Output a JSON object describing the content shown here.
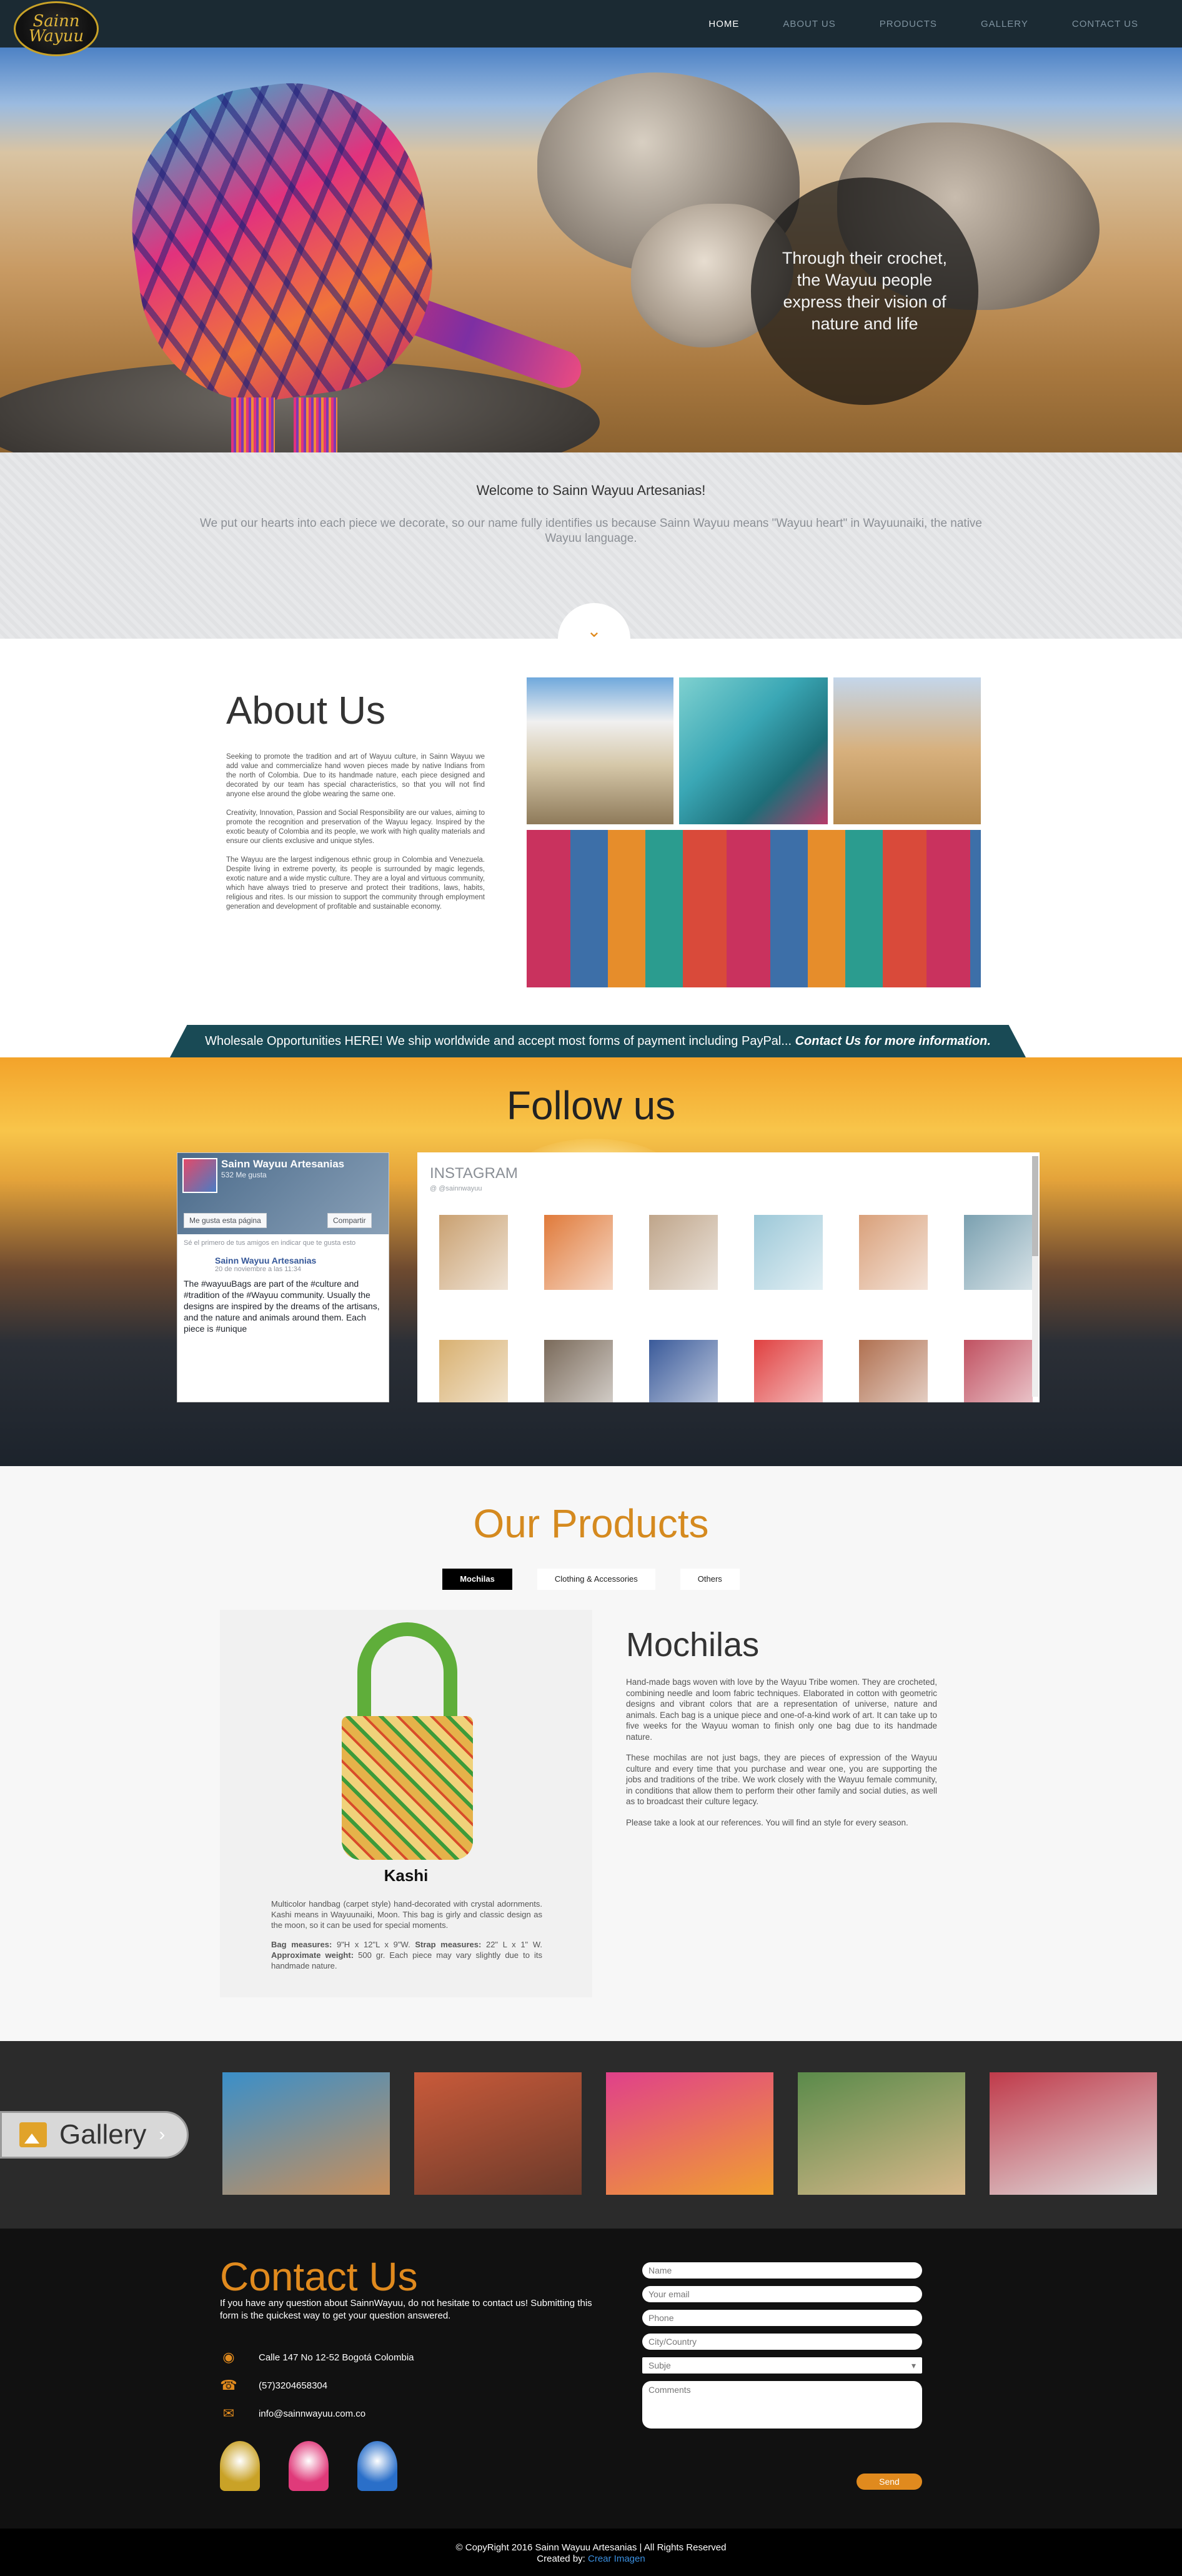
{
  "nav": {
    "logo_text": "Sainn Wayuu",
    "items": [
      {
        "label": "HOME",
        "active": true
      },
      {
        "label": "ABOUT US",
        "active": false
      },
      {
        "label": "PRODUCTS",
        "active": false
      },
      {
        "label": "GALLERY",
        "active": false
      },
      {
        "label": "CONTACT US",
        "active": false
      }
    ]
  },
  "hero": {
    "caption": "Through their crochet, the Wayuu people express their vision of nature and life"
  },
  "welcome": {
    "title": "Welcome to Sainn Wayuu Artesanias!",
    "text": "We put our hearts into each piece we decorate, so our name fully identifies us because Sainn Wayuu means \"Wayuu heart\" in Wayuunaiki, the native Wayuu language.",
    "scroll_icon": "chevron-down-icon"
  },
  "about": {
    "title": "About Us",
    "paragraphs": [
      "Seeking to promote the tradition and art of Wayuu culture, in Sainn Wayuu we add value and commercialize hand woven pieces made by native Indians from the north of Colombia. Due to its handmade nature, each piece designed and decorated by our team has special characteristics, so that you will not find anyone else around the globe wearing the same one.",
      "Creativity, Innovation, Passion and Social Responsibility are our values, aiming to promote the recognition and preservation of the Wayuu legacy. Inspired by the exotic beauty of Colombia and its people, we work with high quality materials and ensure our clients exclusive and unique styles.",
      "The Wayuu are the largest indigenous ethnic group in Colombia and Venezuela. Despite living in extreme poverty, its people is surrounded by magic legends, exotic nature and a wide mystic culture. They are a loyal and virtuous community, which have always tried to preserve and protect their traditions, laws, habits, religious and rites. Is our mission to support the community through employment generation and development of profitable and sustainable economy."
    ]
  },
  "banner": {
    "text": "Wholesale Opportunities HERE! We ship worldwide and accept most forms of payment including PayPal... ",
    "cta": "Contact Us for more information."
  },
  "follow": {
    "title": "Follow us",
    "facebook": {
      "page_name": "Sainn Wayuu Artesanias",
      "likes": "532 Me gusta",
      "like_button": "Me gusta esta página",
      "share_button": "Compartir",
      "note": "Sé el primero de tus amigos en indicar que te gusta esto",
      "post_author": "Sainn Wayuu Artesanias",
      "post_date": "20 de noviembre a las 11:34",
      "post_text": "The #wayuuBags are part of the #culture and #tradition of the #Wayuu community. Usually the designs are inspired by the dreams of the artisans, and the nature and animals around them. Each piece is #unique"
    },
    "instagram": {
      "title": "INSTAGRAM",
      "user": "@ @sainnwayuu",
      "photos": [
        "#c9a070",
        "#e07a3a",
        "#bfa58a",
        "#9cc8d8",
        "#d9a07a",
        "#7aa0b0",
        "#d8b070",
        "#7a6a5a",
        "#3a5a9a",
        "#e04040",
        "#b07050",
        "#c05060"
      ]
    }
  },
  "products": {
    "title": "Our Products",
    "tabs": [
      {
        "label": "Mochilas",
        "active": true
      },
      {
        "label": "Clothing & Accessories",
        "active": false
      },
      {
        "label": "Others",
        "active": false
      }
    ],
    "card": {
      "name": "Kashi",
      "description": "Multicolor handbag (carpet style) hand-decorated with crystal adornments. Kashi means in Wayuunaiki, Moon. This bag is girly and classic design as the moon, so it can be used for special moments.",
      "measures_label": "Bag measures:",
      "measures": " 9\"H x 12\"L x 9\"W. ",
      "strap_label": "Strap measures:",
      "strap": " 22\" L x 1\" W. ",
      "weight_label": "Approximate weight:",
      "weight": " 500 gr. Each piece may vary slightly due to its handmade nature."
    },
    "info": {
      "title": "Mochilas",
      "paragraphs": [
        "Hand-made bags woven with love by the Wayuu Tribe women. They are crocheted, combining needle and loom fabric techniques. Elaborated in cotton with geometric designs and vibrant colors that are a representation of universe, nature and animals. Each bag is a unique piece and one-of-a-kind work of art. It can take up to five weeks for the Wayuu woman to finish only one bag due to its handmade nature.",
        "These mochilas are not just bags, they are pieces of expression of the Wayuu culture and every time that you purchase and wear one, you are supporting the jobs and traditions of the tribe. We work closely with the Wayuu female community, in conditions that allow them to perform their other family and social duties, as well as to broadcast their culture legacy.",
        "Please take a look at our references. You will find an style for every season."
      ]
    }
  },
  "gallery": {
    "label": "Gallery",
    "thumbs": [
      {
        "name": "gallery-thumb-landscape",
        "colors": [
          "#3a8fc9",
          "#c98f5a"
        ]
      },
      {
        "name": "gallery-thumb-clothing",
        "colors": [
          "#c95a3a",
          "#6a3a2a"
        ]
      },
      {
        "name": "gallery-thumb-bags",
        "colors": [
          "#e0408a",
          "#f0a030"
        ]
      },
      {
        "name": "gallery-thumb-women",
        "colors": [
          "#5a8a4a",
          "#d8b88a"
        ]
      },
      {
        "name": "gallery-thumb-market",
        "colors": [
          "#c03a4a",
          "#e0e0e0"
        ]
      }
    ]
  },
  "contact": {
    "title": "Contact Us",
    "intro": "If you have any question about SainnWayuu, do not hesitate to contact us! Submitting this form is the quickest way to get your question answered.",
    "address": "Calle 147 No 12-52 Bogotá Colombia",
    "phone": "(57)3204658304",
    "email": "info@sainnwayuu.com.co",
    "form": {
      "name": "Name",
      "email": "Your email",
      "phone": "Phone",
      "city": "City/Country",
      "subject": "Subje",
      "comments": "Comments",
      "send": "Send"
    },
    "badges": [
      "#c9a227",
      "#e03a7a",
      "#2a6fc9"
    ]
  },
  "footer": {
    "copyright": "© CopyRight 2016 Sainn Wayuu Artesanias | All Rights Reserved",
    "created_by_label": "Created by: ",
    "created_by": "Crear Imagen"
  }
}
